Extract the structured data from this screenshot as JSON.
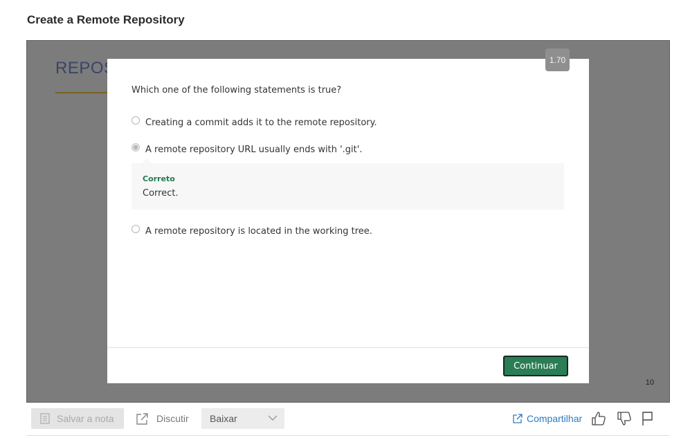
{
  "page": {
    "title": "Create a Remote Repository"
  },
  "slide": {
    "heading": "REPOSITORY",
    "page_number": "10"
  },
  "player": {
    "speed": "1.70"
  },
  "quiz": {
    "question": "Which one of the following statements is true?",
    "options": [
      {
        "label": "Creating a commit adds it to the remote repository.",
        "selected": false
      },
      {
        "label": "A remote repository URL usually ends with '.git'.",
        "selected": true
      },
      {
        "label": "A remote repository is located in the working tree.",
        "selected": false
      }
    ],
    "feedback": {
      "status": "Correto",
      "text": "Correct."
    },
    "continue_label": "Continuar"
  },
  "toolbar": {
    "save_label": "Salvar a nota",
    "discuss_label": "Discutir",
    "download_label": "Baixar",
    "share_label": "Compartilhar"
  },
  "colors": {
    "accent_green": "#2a7d54",
    "feedback_green": "#1f7a4e",
    "link_blue": "#2f7ac0"
  }
}
